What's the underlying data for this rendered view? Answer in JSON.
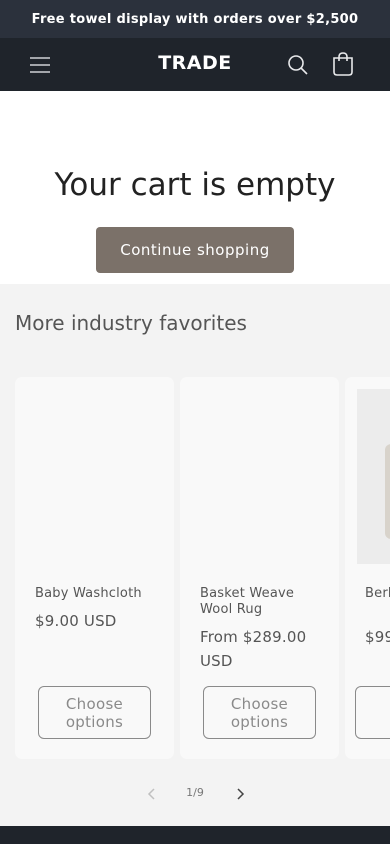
{
  "announcement": "Free towel display with orders over $2,500",
  "header": {
    "logo": "TRADE",
    "menu_icon": "hamburger-menu-icon",
    "search_icon": "search-icon",
    "cart_icon": "cart-icon"
  },
  "cart": {
    "empty_title": "Your cart is empty",
    "continue_label": "Continue shopping"
  },
  "favorites": {
    "heading": "More industry favorites",
    "products": [
      {
        "title": "Baby Washcloth",
        "price": "$9.00 USD",
        "button": "Choose options"
      },
      {
        "title": "Basket Weave Wool Rug",
        "price": "From $289.00 USD",
        "button": "Choose options"
      },
      {
        "title": "Berb Cov",
        "price": "$99",
        "button": ""
      }
    ],
    "pagination": "1/9",
    "prev_icon": "chevron-left-icon",
    "next_icon": "chevron-right-icon"
  },
  "colors": {
    "announcement_bg": "#2b313c",
    "header_bg": "#1f242b",
    "button_bg": "#7b7169",
    "section_bg": "#f3f3f3"
  }
}
